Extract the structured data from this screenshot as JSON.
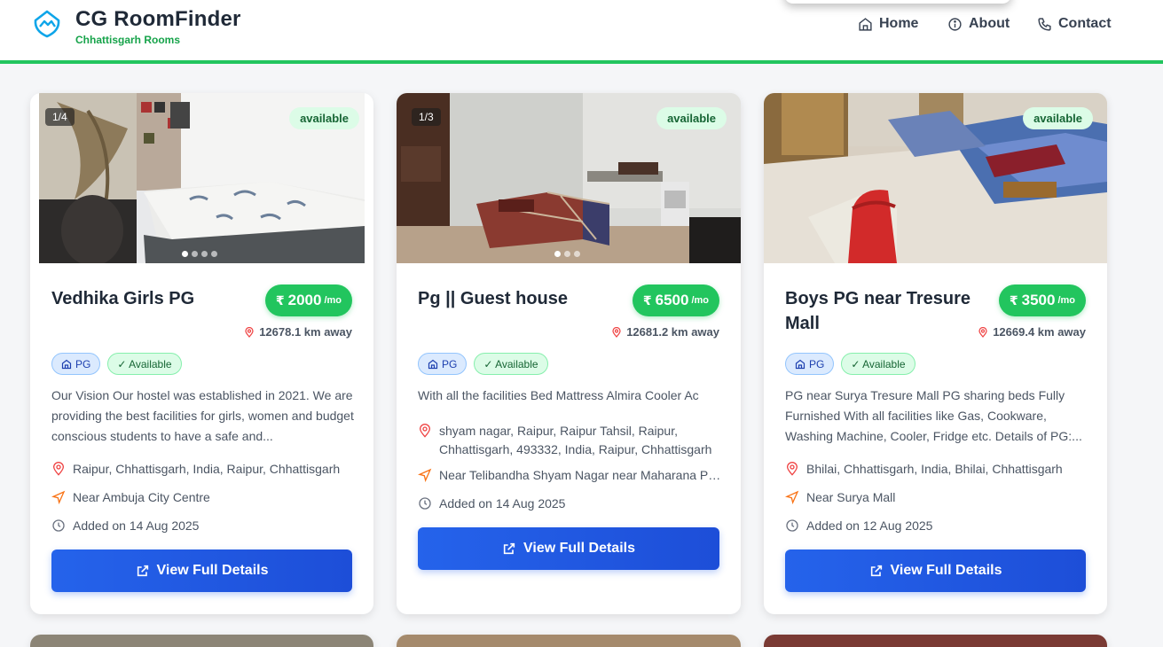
{
  "header": {
    "title": "CG RoomFinder",
    "subtitle": "Chhattisgarh Rooms",
    "nav": [
      {
        "label": "Home",
        "icon": "home-icon"
      },
      {
        "label": "About",
        "icon": "info-icon"
      },
      {
        "label": "Contact",
        "icon": "phone-icon"
      }
    ]
  },
  "colors": {
    "accent": "#22c55e",
    "button": "#2563eb",
    "pin": "#ef4444",
    "nav_arrow": "#f97316"
  },
  "listings": [
    {
      "image_counter": "1/4",
      "image_count": 4,
      "active_image": 1,
      "status": "available",
      "title": "Vedhika Girls PG",
      "currency": "₹",
      "price": "2000",
      "period": "/mo",
      "distance": "12678.1 km away",
      "type_tag": "PG",
      "avail_tag": "✓ Available",
      "description": "Our Vision Our hostel was established in 2021. We are providing the best facilities for girls, women and budget conscious students to have a safe and...",
      "address": "Raipur, Chhattisgarh, India, Raipur, Chhattisgarh",
      "landmark": "Near Ambuja City Centre",
      "added": "Added on 14 Aug 2025",
      "button": "View Full Details"
    },
    {
      "image_counter": "1/3",
      "image_count": 3,
      "active_image": 1,
      "status": "available",
      "title": "Pg || Guest house",
      "currency": "₹",
      "price": "6500",
      "period": "/mo",
      "distance": "12681.2 km away",
      "type_tag": "PG",
      "avail_tag": "✓ Available",
      "description": "With all the facilities Bed Mattress Almira Cooler Ac",
      "address": "shyam nagar, Raipur, Raipur Tahsil, Raipur, Chhattisgarh, 493332, India, Raipur, Chhattisgarh",
      "landmark": "Near Telibandha Shyam Nagar near Maharana Pr...",
      "added": "Added on 14 Aug 2025",
      "button": "View Full Details"
    },
    {
      "image_counter": "",
      "image_count": 0,
      "active_image": 0,
      "status": "available",
      "title": "Boys PG near Tresure Mall",
      "currency": "₹",
      "price": "3500",
      "period": "/mo",
      "distance": "12669.4 km away",
      "type_tag": "PG",
      "avail_tag": "✓ Available",
      "description": "PG near Surya Tresure Mall PG sharing beds Fully Furnished With all facilities like Gas, Cookware, Washing Machine, Cooler, Fridge etc. Details of PG:...",
      "address": "Bhilai, Chhattisgarh, India, Bhilai, Chhattisgarh",
      "landmark": "Near Surya Mall",
      "added": "Added on 12 Aug 2025",
      "button": "View Full Details"
    }
  ]
}
